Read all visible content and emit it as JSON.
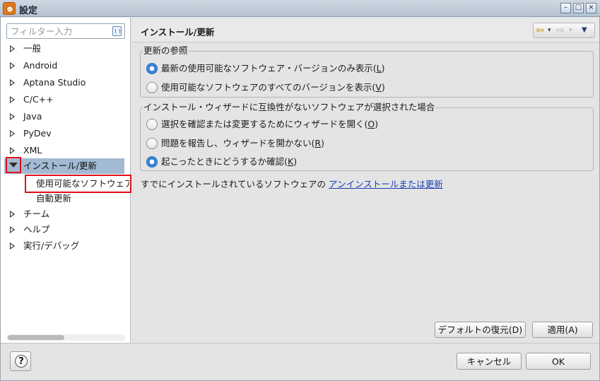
{
  "window": {
    "title": "設定",
    "minimize": "–",
    "maximize": "□",
    "close": "×"
  },
  "filter": {
    "placeholder": "フィルター入力",
    "value": ""
  },
  "tree": {
    "items": [
      {
        "label": "一般"
      },
      {
        "label": "Android"
      },
      {
        "label": "Aptana Studio"
      },
      {
        "label": "C/C++"
      },
      {
        "label": "Java"
      },
      {
        "label": "PyDev"
      },
      {
        "label": "XML"
      }
    ],
    "selected": {
      "label": "インストール/更新"
    },
    "children": [
      {
        "label": "使用可能なソフトウェア"
      },
      {
        "label": "自動更新"
      }
    ],
    "items_after": [
      {
        "label": "チーム"
      },
      {
        "label": "ヘルプ"
      },
      {
        "label": "実行/デバッグ"
      }
    ]
  },
  "page": {
    "title": "インストール/更新",
    "nav": {
      "back": "⇦",
      "forward": "⇨",
      "menu": "▼",
      "back_menu": "▾",
      "forward_menu": "▾"
    }
  },
  "update_group": {
    "title": "更新の参照",
    "options": [
      {
        "label": "最新の使用可能なソフトウェア・バージョンのみ表示(",
        "mnemonic": "L",
        "suffix": ")",
        "checked": true
      },
      {
        "label": "使用可能なソフトウェアのすべてのバージョンを表示(",
        "mnemonic": "V",
        "suffix": ")",
        "checked": false
      }
    ]
  },
  "wizard_group": {
    "title": "インストール・ウィザードに互換性がないソフトウェアが選択された場合",
    "options": [
      {
        "label": "選択を確認または変更するためにウィザードを開く(",
        "mnemonic": "O",
        "suffix": ")",
        "checked": false
      },
      {
        "label": "問題を報告し、ウィザードを開かない(",
        "mnemonic": "R",
        "suffix": ")",
        "checked": false
      },
      {
        "label": "起こったときにどうするか確認(",
        "mnemonic": "K",
        "suffix": ")",
        "checked": true
      }
    ]
  },
  "uninstall": {
    "text": "すでにインストールされているソフトウェアの ",
    "link": "アンインストールまたは更新"
  },
  "buttons": {
    "restore_defaults": "デフォルトの復元(D)",
    "apply": "適用(A)",
    "cancel": "キャンセル",
    "ok": "OK",
    "help": "?"
  },
  "colors": {
    "selection": "#a2bad3",
    "highlight_box": "#e0101c",
    "link": "#1a3fb5",
    "radio_checked": "#3b86d6"
  }
}
